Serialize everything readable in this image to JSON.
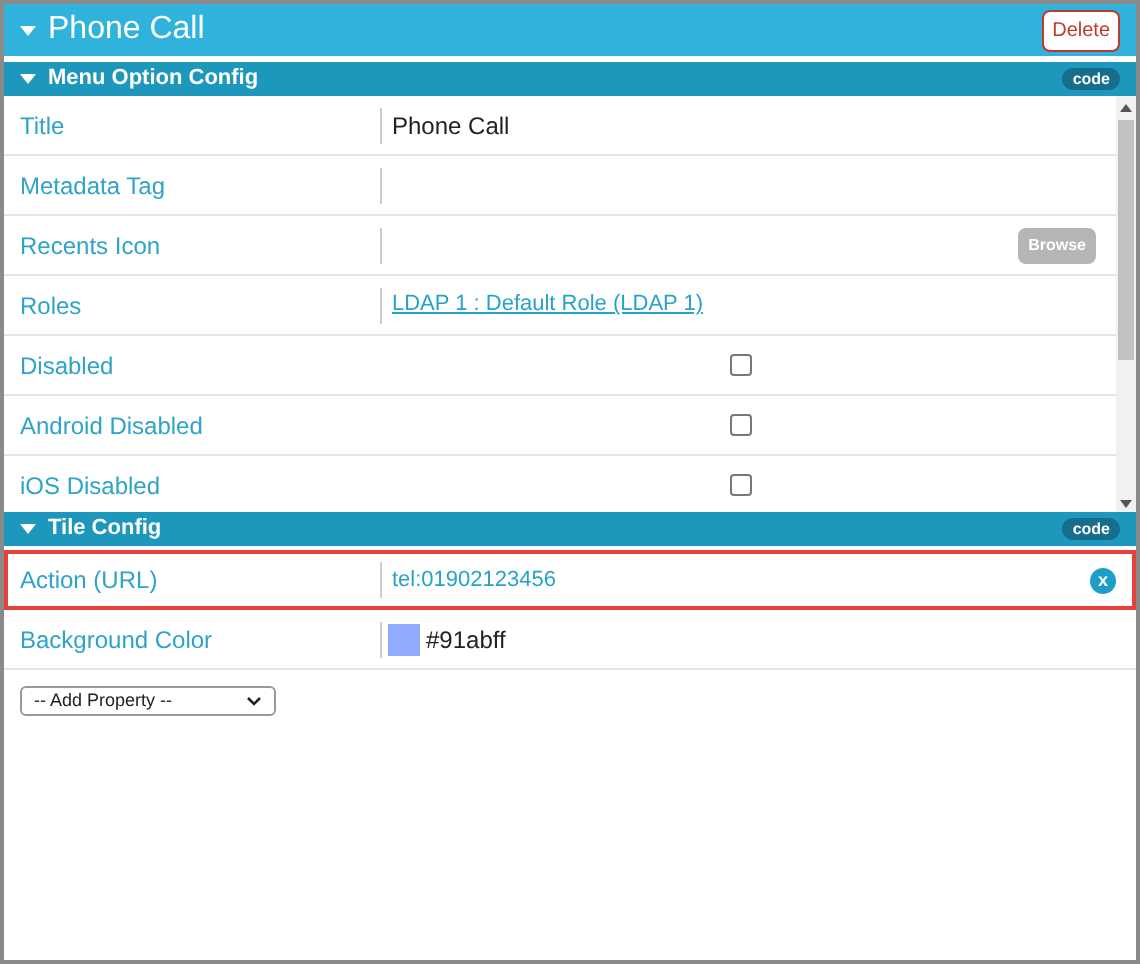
{
  "title": "Phone Call",
  "delete_button": "Delete",
  "sections": [
    {
      "title": "Menu Option Config",
      "code_badge": "code",
      "scrollable": true,
      "rows": [
        {
          "label": "Title",
          "kind": "text",
          "value": "Phone Call"
        },
        {
          "label": "Metadata Tag",
          "kind": "text"
        },
        {
          "label": "Recents Icon",
          "kind": "browse",
          "button": "Browse"
        },
        {
          "label": "Roles",
          "kind": "link",
          "value": "LDAP 1 : Default Role (LDAP 1)"
        },
        {
          "label": "Disabled",
          "kind": "checkbox",
          "checked": false
        },
        {
          "label": "Android Disabled",
          "kind": "checkbox",
          "checked": false
        },
        {
          "label": "iOS Disabled",
          "kind": "checkbox",
          "checked": false
        }
      ]
    },
    {
      "title": "Tile Config",
      "code_badge": "code",
      "scrollable": false,
      "rows": [
        {
          "label": "Action (URL)",
          "kind": "url",
          "value": "tel:01902123456",
          "highlighted": true,
          "clear_button": "x"
        },
        {
          "label": "Background Color",
          "kind": "color",
          "value": "#91abff",
          "color": "#91abff"
        }
      ]
    }
  ],
  "add_property": "-- Add Property --"
}
